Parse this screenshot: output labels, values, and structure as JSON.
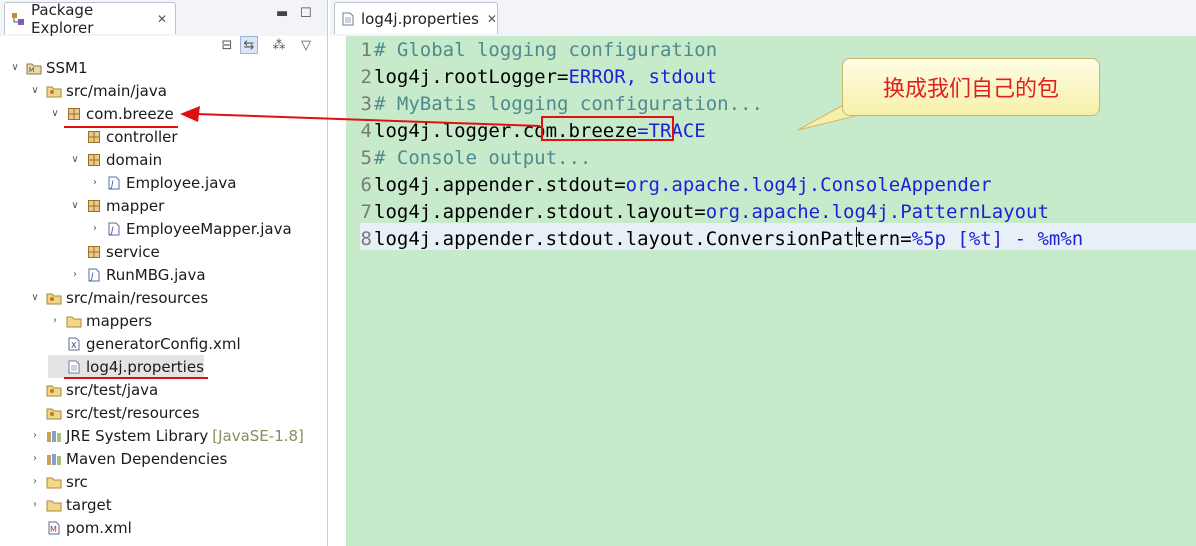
{
  "left": {
    "tab_title": "Package Explorer",
    "tab_close": "✕",
    "tree": [
      {
        "label": "SSM1",
        "indent": 0,
        "twisty": "∨",
        "icon": "project-icon"
      },
      {
        "label": "src/main/java",
        "indent": 1,
        "twisty": "∨",
        "icon": "source-folder-icon"
      },
      {
        "label": "com.breeze",
        "indent": 2,
        "twisty": "∨",
        "icon": "package-icon"
      },
      {
        "label": "controller",
        "indent": 3,
        "twisty": "",
        "icon": "package-icon"
      },
      {
        "label": "domain",
        "indent": 3,
        "twisty": "∨",
        "icon": "package-icon"
      },
      {
        "label": "Employee.java",
        "indent": 4,
        "twisty": "›",
        "icon": "java-file-icon"
      },
      {
        "label": "mapper",
        "indent": 3,
        "twisty": "∨",
        "icon": "package-icon"
      },
      {
        "label": "EmployeeMapper.java",
        "indent": 4,
        "twisty": "›",
        "icon": "java-interface-icon"
      },
      {
        "label": "service",
        "indent": 3,
        "twisty": "",
        "icon": "package-icon"
      },
      {
        "label": "RunMBG.java",
        "indent": 3,
        "twisty": "›",
        "icon": "java-file-icon"
      },
      {
        "label": "src/main/resources",
        "indent": 1,
        "twisty": "∨",
        "icon": "source-folder-icon"
      },
      {
        "label": "mappers",
        "indent": 2,
        "twisty": "›",
        "icon": "folder-icon"
      },
      {
        "label": "generatorConfig.xml",
        "indent": 2,
        "twisty": "",
        "icon": "xml-file-icon"
      },
      {
        "label": "log4j.properties",
        "indent": 2,
        "twisty": "",
        "icon": "text-file-icon",
        "selected": true
      },
      {
        "label": "src/test/java",
        "indent": 1,
        "twisty": "",
        "icon": "source-folder-icon"
      },
      {
        "label": "src/test/resources",
        "indent": 1,
        "twisty": "",
        "icon": "source-folder-icon"
      },
      {
        "label": "JRE System Library",
        "indent": 1,
        "twisty": "›",
        "icon": "library-icon",
        "decoration": "[JavaSE-1.8]"
      },
      {
        "label": "Maven Dependencies",
        "indent": 1,
        "twisty": "›",
        "icon": "library-icon"
      },
      {
        "label": "src",
        "indent": 1,
        "twisty": "›",
        "icon": "folder-icon"
      },
      {
        "label": "target",
        "indent": 1,
        "twisty": "›",
        "icon": "folder-icon"
      },
      {
        "label": "pom.xml",
        "indent": 1,
        "twisty": "",
        "icon": "maven-file-icon"
      }
    ]
  },
  "editor": {
    "tab_title": "log4j.properties",
    "tab_close": "✕",
    "lines": [
      {
        "n": "1",
        "parts": [
          {
            "t": "# Global logging configuration",
            "c": "cm"
          }
        ]
      },
      {
        "n": "2",
        "parts": [
          {
            "t": "log4j.rootLogger=",
            "c": "kw"
          },
          {
            "t": "ERROR, stdout",
            "c": "vl"
          }
        ]
      },
      {
        "n": "3",
        "parts": [
          {
            "t": "# MyBatis logging configuration...",
            "c": "cm"
          }
        ]
      },
      {
        "n": "4",
        "parts": [
          {
            "t": "log4j.logger.",
            "c": "kw"
          },
          {
            "t": "com.breeze",
            "c": "kw"
          },
          {
            "t": "=TRACE",
            "c": "vl"
          }
        ]
      },
      {
        "n": "5",
        "parts": [
          {
            "t": "# Console output...",
            "c": "cm"
          }
        ]
      },
      {
        "n": "6",
        "parts": [
          {
            "t": "log4j.appender.stdout=",
            "c": "kw"
          },
          {
            "t": "org.apache.log4j.ConsoleAppender",
            "c": "vl"
          }
        ]
      },
      {
        "n": "7",
        "parts": [
          {
            "t": "log4j.appender.stdout.layout=",
            "c": "kw"
          },
          {
            "t": "org.apache.log4j.PatternLayout",
            "c": "vl"
          }
        ]
      },
      {
        "n": "8",
        "parts": [
          {
            "t": "log4j.appender.stdout.layout.ConversionPattern=",
            "c": "kw"
          },
          {
            "t": "%5p [%t] - %m%n",
            "c": "vl"
          }
        ]
      }
    ]
  },
  "callout": {
    "text": "换成我们自己的包"
  },
  "colors": {
    "annotation_red": "#e01010",
    "editor_bg": "#c7eacb",
    "comment": "#4f8a8f",
    "value": "#1f1fd8"
  }
}
